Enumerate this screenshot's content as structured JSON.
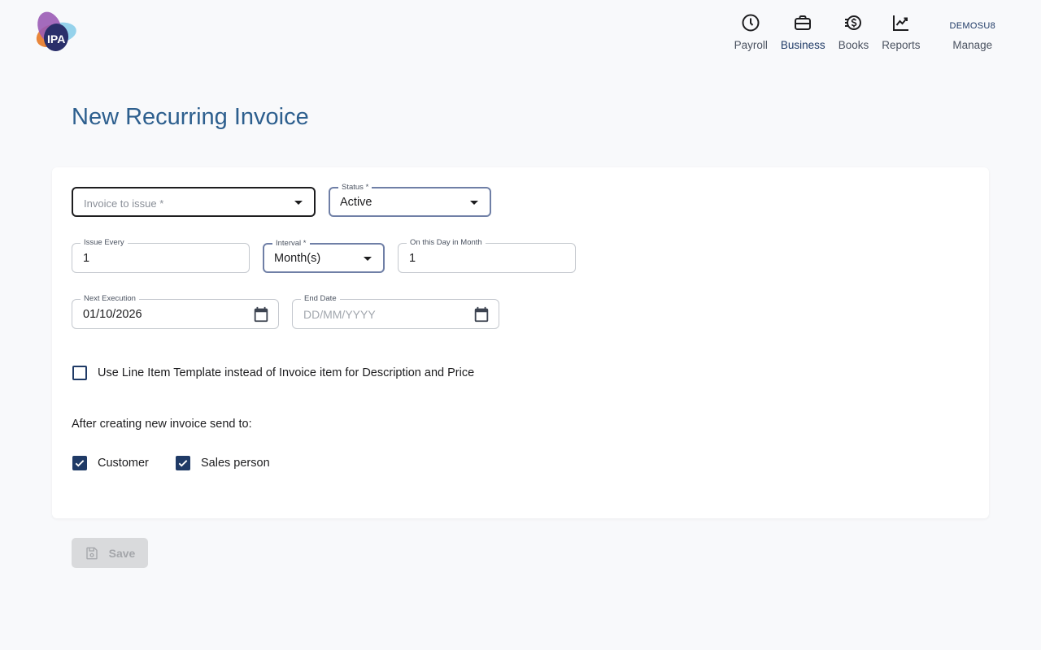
{
  "brand": {
    "logo_text": "IPA"
  },
  "nav": {
    "items": [
      {
        "label": "Payroll",
        "icon": "clock-icon"
      },
      {
        "label": "Business",
        "icon": "briefcase-icon"
      },
      {
        "label": "Books",
        "icon": "dollar-coin-icon"
      },
      {
        "label": "Reports",
        "icon": "trending-chart-icon"
      }
    ],
    "user": {
      "name": "DEMOSU8",
      "label": "Manage"
    }
  },
  "page": {
    "title": "New Recurring Invoice"
  },
  "form": {
    "invoice_to_issue": {
      "placeholder": "Invoice to issue *"
    },
    "status": {
      "label": "Status *",
      "value": "Active"
    },
    "issue_every": {
      "label": "Issue Every",
      "value": "1"
    },
    "interval": {
      "label": "Interval *",
      "value": "Month(s)"
    },
    "on_this_day": {
      "label": "On this Day in Month",
      "value": "1"
    },
    "next_execution": {
      "label": "Next Execution",
      "value": "01/10/2026"
    },
    "end_date": {
      "label": "End Date",
      "placeholder": "DD/MM/YYYY"
    },
    "line_item_template": {
      "label": "Use Line Item Template instead of Invoice item for Description and Price",
      "checked": false
    },
    "send_to_heading": "After creating new invoice send to:",
    "send_to": [
      {
        "label": "Customer",
        "checked": true
      },
      {
        "label": "Sales person",
        "checked": true
      }
    ]
  },
  "actions": {
    "save_label": "Save"
  },
  "colors": {
    "accent": "#1f3a66",
    "title": "#2d5f8e"
  }
}
